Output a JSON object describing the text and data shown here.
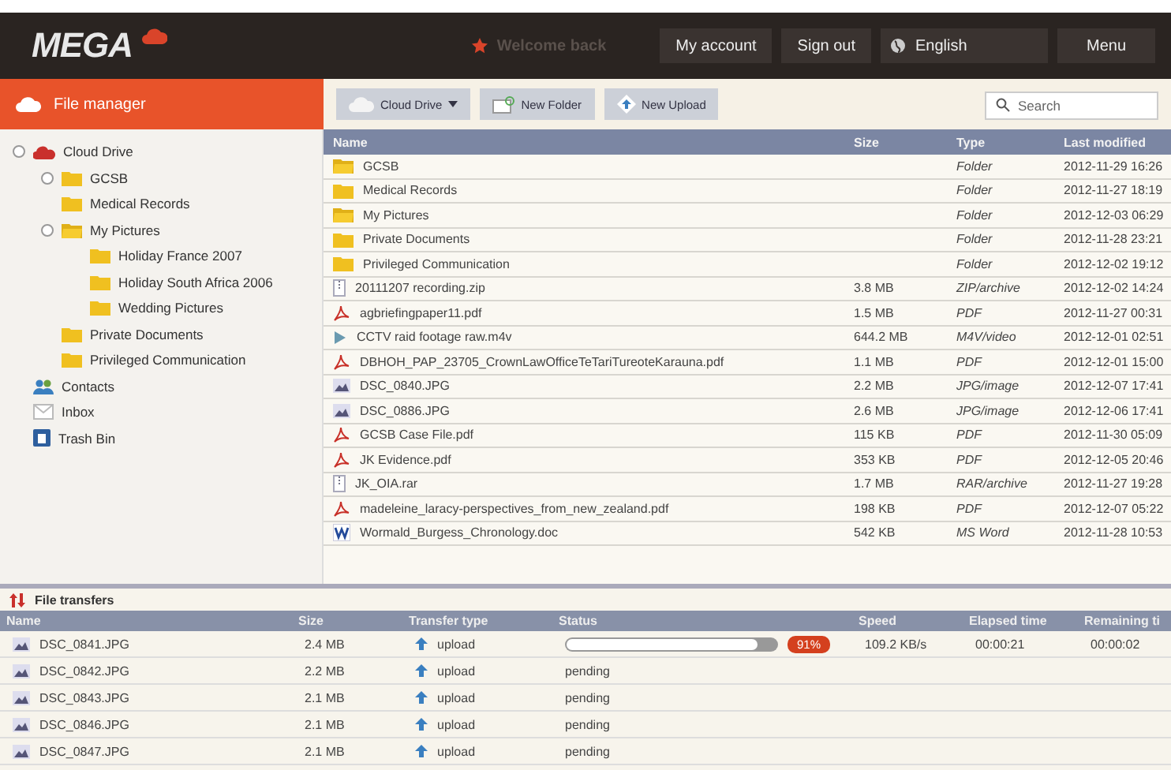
{
  "header": {
    "logo": "MEGA",
    "welcome": "Welcome back",
    "buttons": [
      "My account",
      "Sign out"
    ],
    "language": "English",
    "menu": "Menu"
  },
  "sidebar": {
    "title": "File manager",
    "tree": [
      {
        "label": "Cloud Drive",
        "kind": "cloud",
        "expander": true,
        "children": [
          {
            "label": "GCSB",
            "kind": "folder",
            "expander": true
          },
          {
            "label": "Medical Records",
            "kind": "folder",
            "expander": false
          },
          {
            "label": "My Pictures",
            "kind": "folder-open",
            "expander": true,
            "children": [
              {
                "label": "Holiday France 2007",
                "kind": "folder",
                "expander": false
              },
              {
                "label": "Holiday South Africa 2006",
                "kind": "folder",
                "expander": false
              },
              {
                "label": "Wedding Pictures",
                "kind": "folder",
                "expander": false
              }
            ]
          },
          {
            "label": "Private Documents",
            "kind": "folder",
            "expander": false
          },
          {
            "label": "Privileged Communication",
            "kind": "folder",
            "expander": false
          }
        ]
      },
      {
        "label": "Contacts",
        "kind": "contacts",
        "expander": false
      },
      {
        "label": "Inbox",
        "kind": "inbox",
        "expander": false
      },
      {
        "label": "Trash Bin",
        "kind": "trash",
        "expander": false
      }
    ]
  },
  "toolbar": {
    "buttons": [
      {
        "label": "Cloud Drive",
        "kind": "dropdown"
      },
      {
        "label": "New Folder",
        "kind": "folder"
      },
      {
        "label": "New Upload",
        "kind": "upload"
      }
    ],
    "search": {
      "placeholder": "Search"
    }
  },
  "table": {
    "columns": [
      "Name",
      "Size",
      "Type",
      "Last modified"
    ],
    "rows": [
      {
        "kind": "folder-open",
        "name": "GCSB",
        "size": "",
        "type": "Folder",
        "modified": "2012-11-29 16:26"
      },
      {
        "kind": "folder",
        "name": "Medical Records",
        "size": "",
        "type": "Folder",
        "modified": "2012-11-27 18:19"
      },
      {
        "kind": "folder-open",
        "name": "My Pictures",
        "size": "",
        "type": "Folder",
        "modified": "2012-12-03 06:29"
      },
      {
        "kind": "folder",
        "name": "Private Documents",
        "size": "",
        "type": "Folder",
        "modified": "2012-11-28 23:21"
      },
      {
        "kind": "folder",
        "name": "Privileged Communication",
        "size": "",
        "type": "Folder",
        "modified": "2012-12-02 19:12"
      },
      {
        "kind": "archive",
        "name": "20111207 recording.zip",
        "size": "3.8 MB",
        "type": "ZIP/archive",
        "modified": "2012-12-02 14:24"
      },
      {
        "kind": "pdf",
        "name": "agbriefingpaper11.pdf",
        "size": "1.5 MB",
        "type": "PDF",
        "modified": "2012-11-27 00:31"
      },
      {
        "kind": "video",
        "name": "CCTV raid footage raw.m4v",
        "size": "644.2 MB",
        "type": "M4V/video",
        "modified": "2012-12-01 02:51"
      },
      {
        "kind": "pdf",
        "name": "DBHOH_PAP_23705_CrownLawOfficeTeTariTureoteKarauna.pdf",
        "size": "1.1 MB",
        "type": "PDF",
        "modified": "2012-12-01 15:00"
      },
      {
        "kind": "image",
        "name": "DSC_0840.JPG",
        "size": "2.2 MB",
        "type": "JPG/image",
        "modified": "2012-12-07 17:41"
      },
      {
        "kind": "image",
        "name": "DSC_0886.JPG",
        "size": "2.6 MB",
        "type": "JPG/image",
        "modified": "2012-12-06 17:41"
      },
      {
        "kind": "pdf",
        "name": "GCSB Case File.pdf",
        "size": "115 KB",
        "type": "PDF",
        "modified": "2012-11-30 05:09"
      },
      {
        "kind": "pdf",
        "name": "JK Evidence.pdf",
        "size": "353 KB",
        "type": "PDF",
        "modified": "2012-12-05 20:46"
      },
      {
        "kind": "archive",
        "name": "JK_OIA.rar",
        "size": "1.7 MB",
        "type": "RAR/archive",
        "modified": "2012-11-27 19:28"
      },
      {
        "kind": "pdf",
        "name": "madeleine_laracy-perspectives_from_new_zealand.pdf",
        "size": "198 KB",
        "type": "PDF",
        "modified": "2012-12-07 05:22"
      },
      {
        "kind": "word",
        "name": "Wormald_Burgess_Chronology.doc",
        "size": "542 KB",
        "type": "MS Word",
        "modified": "2012-11-28 10:53"
      }
    ]
  },
  "transfers": {
    "title": "File transfers",
    "columns": [
      "Name",
      "Size",
      "Transfer type",
      "Status",
      "Speed",
      "Elapsed time",
      "Remaining ti"
    ],
    "rows": [
      {
        "name": "DSC_0841.JPG",
        "size": "2.4 MB",
        "type": "upload",
        "kind": "progress",
        "level": 0.91,
        "percent": "91%",
        "speed": "109.2 KB/s",
        "elapsed": "00:00:21",
        "remaining": "00:00:02"
      },
      {
        "name": "DSC_0842.JPG",
        "size": "2.2 MB",
        "type": "upload",
        "kind": "pending",
        "status": "pending"
      },
      {
        "name": "DSC_0843.JPG",
        "size": "2.1 MB",
        "type": "upload",
        "kind": "pending",
        "status": "pending"
      },
      {
        "name": "DSC_0846.JPG",
        "size": "2.1 MB",
        "type": "upload",
        "kind": "pending",
        "status": "pending"
      },
      {
        "name": "DSC_0847.JPG",
        "size": "2.1 MB",
        "type": "upload",
        "kind": "pending",
        "status": "pending"
      }
    ]
  }
}
